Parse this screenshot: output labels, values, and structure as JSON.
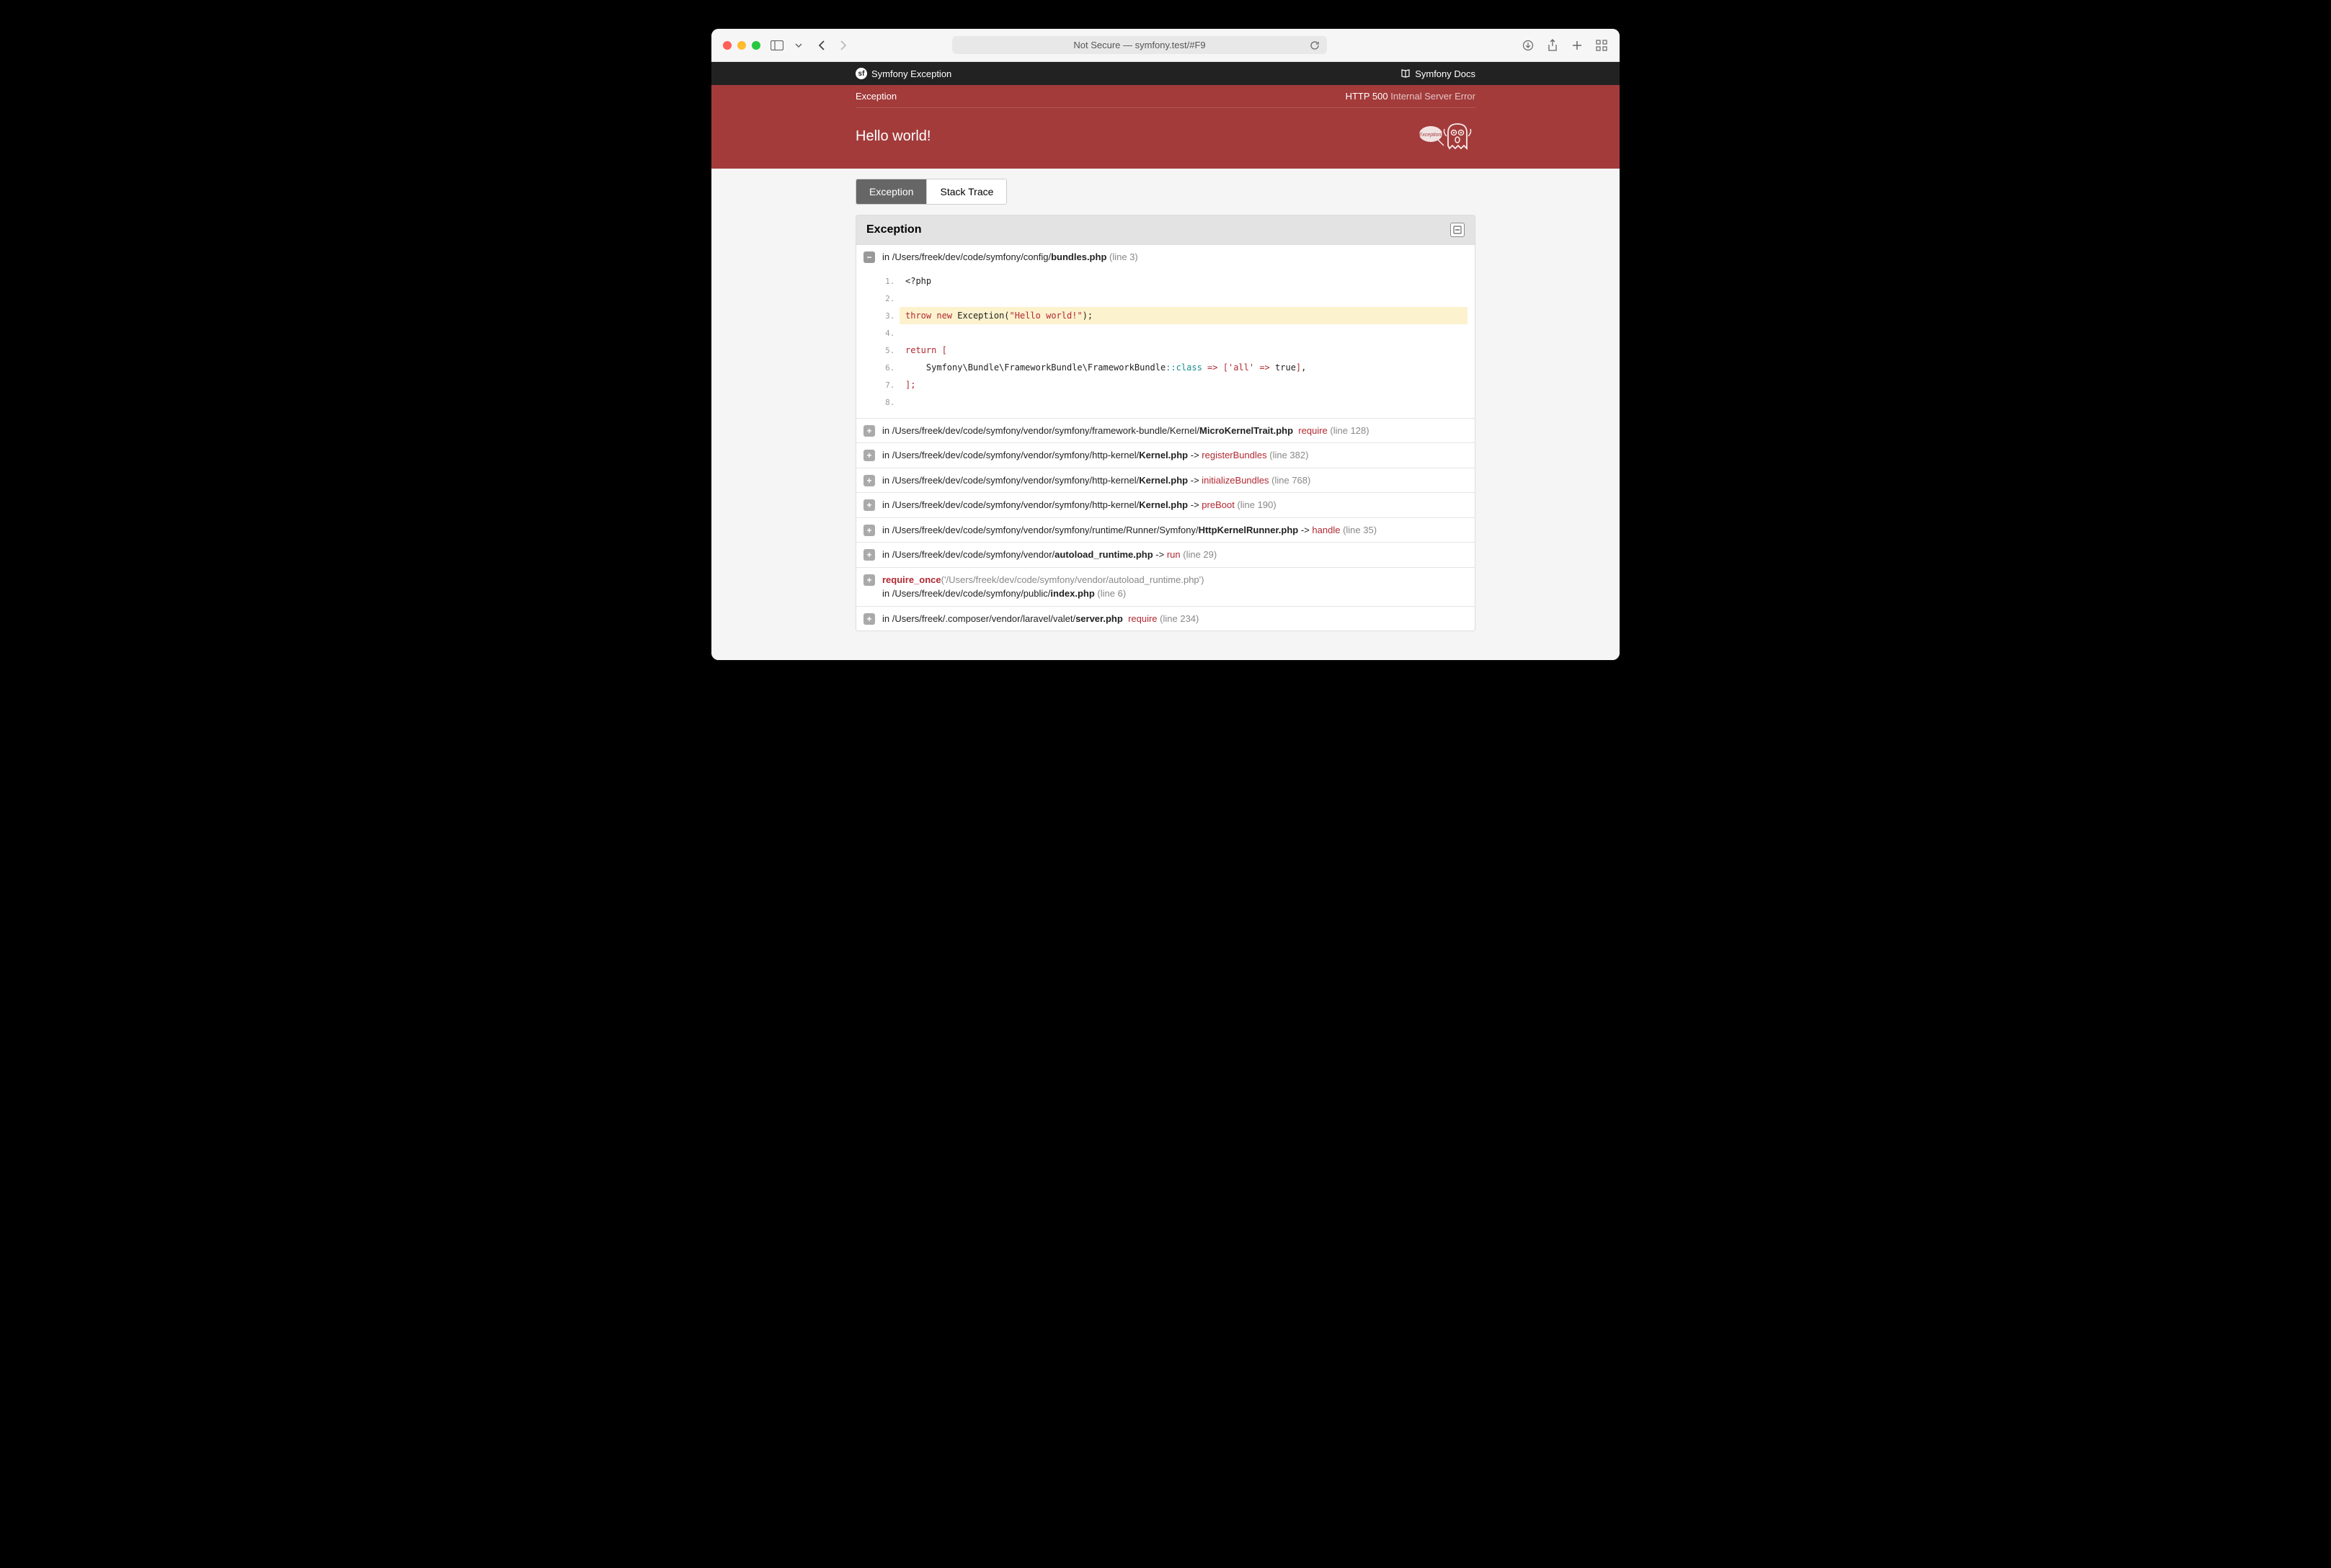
{
  "browser": {
    "address": "Not Secure — symfony.test/#F9"
  },
  "topbar": {
    "brand": "Symfony Exception",
    "docs": "Symfony Docs"
  },
  "error": {
    "exception_class": "Exception",
    "http_prefix": "HTTP 500",
    "http_text": "Internal Server Error",
    "title": "Hello world!"
  },
  "tabs": [
    {
      "label": "Exception",
      "active": true
    },
    {
      "label": "Stack Trace",
      "active": false
    }
  ],
  "panel_title": "Exception",
  "main_trace": {
    "prefix": "in /Users/freek/dev/code/symfony/config/",
    "file": "bundles.php",
    "line_text": "(line 3)",
    "code_start": 1,
    "highlight_line": 3,
    "code": [
      {
        "n": 1,
        "html": "&lt;?php"
      },
      {
        "n": 2,
        "html": ""
      },
      {
        "n": 3,
        "html": "<span class='tok-keyword'>throw</span> <span class='tok-keyword'>new</span> Exception(<span class='tok-string'>\"Hello world!\"</span>);"
      },
      {
        "n": 4,
        "html": ""
      },
      {
        "n": 5,
        "html": "<span class='tok-keyword'>return</span> <span class='tok-punct'>[</span>"
      },
      {
        "n": 6,
        "html": "&nbsp;&nbsp;&nbsp;&nbsp;Symfony\\Bundle\\FrameworkBundle\\FrameworkBundle<span class='tok-class'>::class</span> <span class='tok-keyword'>=&gt;</span> <span class='tok-punct'>[</span><span class='tok-string'>'all'</span> <span class='tok-keyword'>=&gt;</span> <span class='tok-bool'>true</span><span class='tok-punct'>]</span>,"
      },
      {
        "n": 7,
        "html": "<span class='tok-punct'>];</span>"
      },
      {
        "n": 8,
        "html": ""
      }
    ]
  },
  "traces": [
    {
      "prefix": "in /Users/freek/dev/code/symfony/vendor/symfony/framework-bundle/Kernel/",
      "file": "MicroKernelTrait.php",
      "arrow": "",
      "fn": "require",
      "line": "(line 128)"
    },
    {
      "prefix": "in /Users/freek/dev/code/symfony/vendor/symfony/http-kernel/",
      "file": "Kernel.php",
      "arrow": " -> ",
      "fn": "registerBundles",
      "line": "(line 382)"
    },
    {
      "prefix": "in /Users/freek/dev/code/symfony/vendor/symfony/http-kernel/",
      "file": "Kernel.php",
      "arrow": " -> ",
      "fn": "initializeBundles",
      "line": "(line 768)"
    },
    {
      "prefix": "in /Users/freek/dev/code/symfony/vendor/symfony/http-kernel/",
      "file": "Kernel.php",
      "arrow": " -> ",
      "fn": "preBoot",
      "line": "(line 190)"
    },
    {
      "prefix": "in /Users/freek/dev/code/symfony/vendor/symfony/runtime/Runner/Symfony/",
      "file": "HttpKernelRunner.php",
      "arrow": " -> ",
      "fn": "handle",
      "line": "(line 35)"
    },
    {
      "prefix": "in /Users/freek/dev/code/symfony/vendor/",
      "file": "autoload_runtime.php",
      "arrow": " -> ",
      "fn": "run",
      "line": "(line 29)"
    },
    {
      "special_fn": "require_once",
      "special_arg": "('/Users/freek/dev/code/symfony/vendor/autoload_runtime.php')",
      "prefix": "in /Users/freek/dev/code/symfony/public/",
      "file": "index.php",
      "arrow": "",
      "fn": "",
      "line": "(line 6)"
    },
    {
      "prefix": "in /Users/freek/.composer/vendor/laravel/valet/",
      "file": "server.php",
      "arrow": "",
      "fn": "require",
      "line": "(line 234)"
    }
  ]
}
